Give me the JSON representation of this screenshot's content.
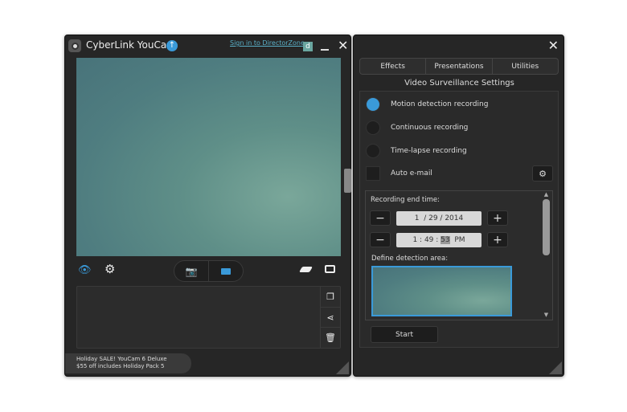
{
  "left": {
    "title": "CyberLink YouCam",
    "sign_in": "Sign in to DirectorZone",
    "dz_badge": "d",
    "promo_line1": "Holiday SALE! YouCam 6 Deluxe",
    "promo_line2": "$55 off includes Holiday Pack 5"
  },
  "right": {
    "tabs": [
      "Effects",
      "Presentations",
      "Utilities"
    ],
    "heading": "Video Surveillance Settings",
    "options": [
      {
        "label": "Motion detection recording",
        "selected": true
      },
      {
        "label": "Continuous recording",
        "selected": false
      },
      {
        "label": "Time-lapse recording",
        "selected": false
      }
    ],
    "auto_email": "Auto e-mail",
    "end_time_label": "Recording end time:",
    "date": {
      "month": "1",
      "day": "29",
      "year": "2014"
    },
    "time": {
      "hour": "1",
      "minute": "49",
      "second": "53",
      "ampm": "PM"
    },
    "detection_label": "Define detection area:",
    "start": "Start"
  },
  "colors": {
    "accent": "#3a9ad9"
  }
}
